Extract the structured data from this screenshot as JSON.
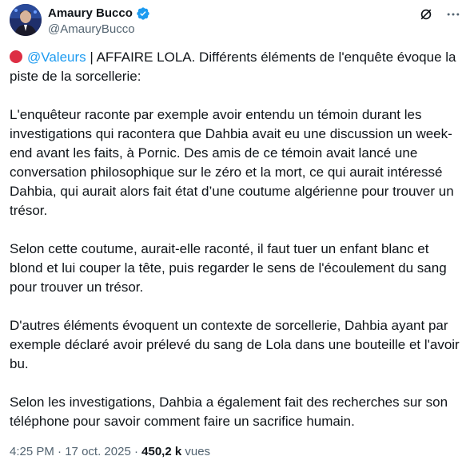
{
  "author": {
    "display_name": "Amaury Bucco",
    "handle": "@AmauryBucco",
    "verified": true
  },
  "colors": {
    "accent": "#1d9bf0",
    "text": "#0f1419",
    "secondary": "#536471",
    "red_circle": "#dd2e44"
  },
  "icons": {
    "grok": "grok-icon",
    "more": "more-options-icon",
    "verified": "verified-badge-icon",
    "red_circle": "red-circle-emoji"
  },
  "tweet": {
    "mention": "@Valeurs",
    "paragraph1_rest": " | AFFAIRE LOLA. Différents éléments de l'enquête évoque la piste de la sorcellerie:",
    "paragraph2": "L'enquêteur raconte par exemple avoir entendu un témoin durant les investigations qui racontera que Dahbia avait eu une discussion un week-end avant les faits, à Pornic. Des amis de ce témoin avait lancé une conversation philosophique sur le zéro et la mort, ce qui aurait intéressé Dahbia, qui aurait alors fait état d’une coutume algérienne pour trouver un trésor.",
    "paragraph3": "Selon cette coutume, aurait-elle raconté, il faut tuer un enfant blanc et blond et lui couper la tête, puis regarder le sens de l'écoulement du sang pour trouver un trésor.",
    "paragraph4": "D'autres éléments évoquent un contexte de sorcellerie, Dahbia ayant par exemple déclaré avoir prélevé du sang de Lola dans une bouteille et l'avoir bu.",
    "paragraph5": "Selon les investigations, Dahbia a également fait des recherches sur son téléphone pour savoir comment faire un sacrifice humain."
  },
  "meta": {
    "time": "4:25 PM",
    "separator": " · ",
    "date": "17 oct. 2025",
    "views_count": "450,2 k",
    "views_label": " vues"
  }
}
